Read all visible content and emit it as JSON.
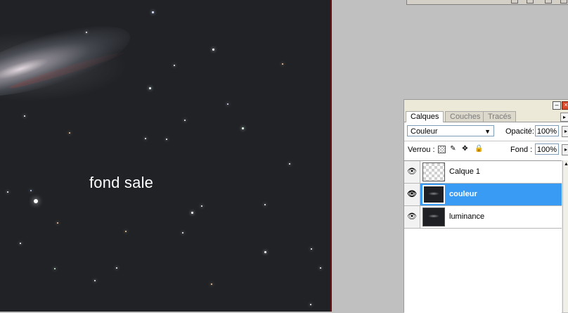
{
  "canvas": {
    "caption": "fond sale"
  },
  "palette": {
    "tabs": [
      {
        "label": "Calques",
        "active": true
      },
      {
        "label": "Couches",
        "active": false
      },
      {
        "label": "Tracés",
        "active": false
      }
    ],
    "blend_mode": "Couleur",
    "opacity_label": "Opacité:",
    "opacity_value": "100%",
    "lock_label": "Verrou :",
    "fill_label": "Fond :",
    "fill_value": "100%",
    "layers": [
      {
        "name": "Calque 1",
        "visible": true,
        "thumbnail": "transparent",
        "selected": false
      },
      {
        "name": "couleur",
        "visible": true,
        "thumbnail": "dark-galaxy",
        "selected": true
      },
      {
        "name": "luminance",
        "visible": true,
        "thumbnail": "dark-galaxy",
        "selected": false
      }
    ]
  },
  "icons": {
    "eye": "eye-icon",
    "lock_transparent": "lock-transparency-icon",
    "lock_brush": "brush-icon",
    "lock_move": "move-icon",
    "lock_all": "padlock-icon",
    "minimize": "minimize-icon",
    "close": "close-icon",
    "menu": "palette-menu-icon",
    "dropdown": "chevron-down-icon"
  },
  "colors": {
    "selection": "#3a9bf5",
    "canvas_background": "#202226",
    "workspace": "#c0c0c0"
  }
}
